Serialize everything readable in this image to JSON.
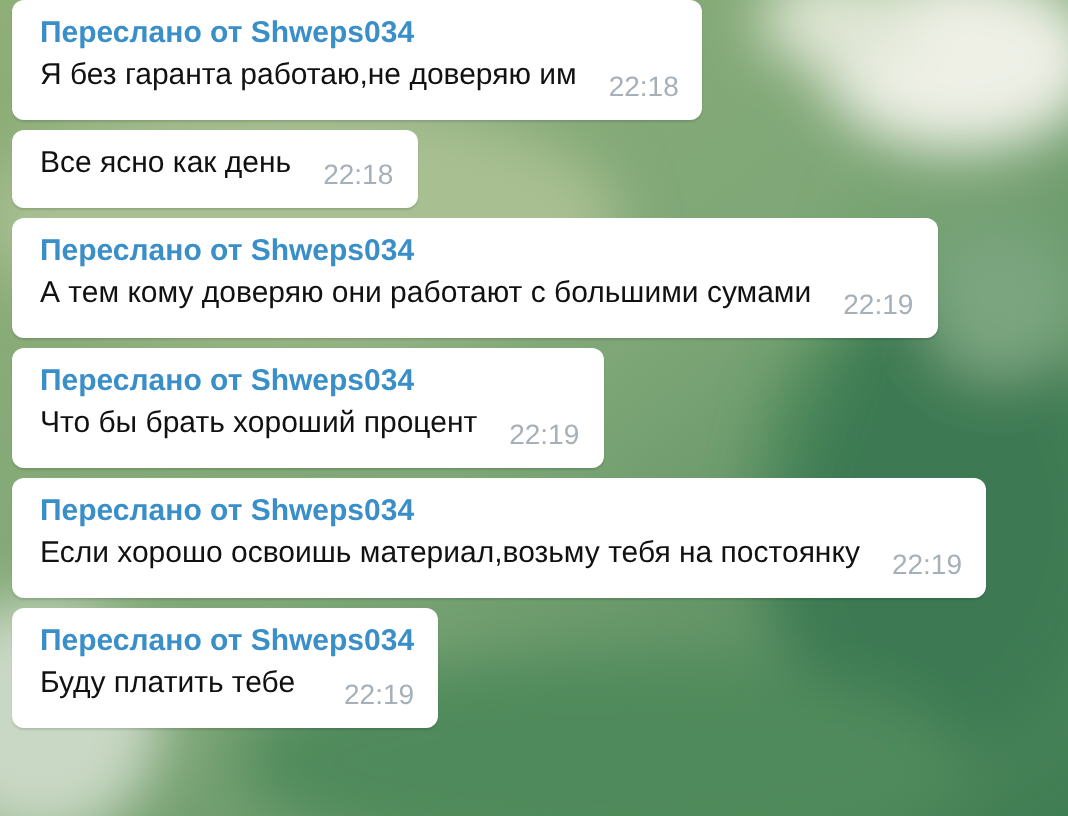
{
  "messages": [
    {
      "forwarded_from": "Переслано от Shweps034",
      "text": "Я без гаранта работаю,не доверяю им",
      "time": "22:18"
    },
    {
      "text": "Все ясно как день",
      "time": "22:18"
    },
    {
      "forwarded_from": "Переслано от Shweps034",
      "text": "А тем кому доверяю они работают с большими сумами",
      "time": "22:19"
    },
    {
      "forwarded_from": "Переслано от Shweps034",
      "text": "Что бы брать хороший процент",
      "time": "22:19"
    },
    {
      "forwarded_from": "Переслано от Shweps034",
      "text": "Если хорошо освоишь материал,возьму тебя на постоянку",
      "time": "22:19"
    },
    {
      "forwarded_from": "Переслано от Shweps034",
      "text": "Буду платить тебе",
      "time": "22:19"
    }
  ]
}
